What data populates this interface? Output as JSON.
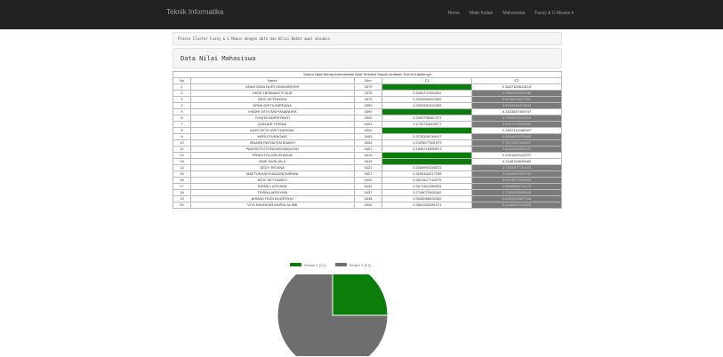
{
  "nav": {
    "brand": "Teknik Informatika",
    "links": [
      "Home",
      "Mata Kuliah",
      "Mahasiswa",
      "Fuzzy & C-Means ▾"
    ]
  },
  "notice": "Proses Cluster Fuzzy & C-Means dengan data dan Nilai Bobot awal dinamis",
  "section_title": "Data Nilai Mahasiswa",
  "table": {
    "caption": "Warna Hijau Merepresentasikan Nilai Tersebut Masuk kedalam Kolum Klasternya",
    "headers": [
      "No",
      "Nama",
      "Nim",
      "C1",
      "C2"
    ],
    "rows": [
      [
        "1",
        "ANASTASIA NURI GINANINGSIH",
        "3372",
        "",
        "0.3637160613219"
      ],
      [
        "2",
        "DEDE HERMANTO NUR",
        "3375",
        "0.4040747052652",
        "0.5959252947348"
      ],
      [
        "3",
        "DEDI SETYAWAN",
        "3379",
        "0.3269984322669",
        "0.6730015677331"
      ],
      [
        "4",
        "ERNA DHITA WIRDANA",
        "3390",
        "0.3305461624455",
        "0.6694538375545"
      ],
      [
        "5",
        "VINDHI DESI WIDYANANDRA",
        "3390",
        "",
        "0.3103637490747"
      ],
      [
        "6",
        "YUNITA NURHIYANTI",
        "3392",
        "0.2930796567477",
        "0.7069203432523"
      ],
      [
        "7",
        "GANJAR TRISNA",
        "3401",
        "0.1732784003977",
        "0.8267215996023"
      ],
      [
        "8",
        "HARI OKTA DWI TUKODAL",
        "3402",
        "",
        "0.2697112048307"
      ],
      [
        "9",
        "HERU PURNOMO",
        "3403",
        "0.3735106749017",
        "0.6264893250983"
      ],
      [
        "10",
        "ISNAINI RATNA RAHDIANTI",
        "3404",
        "0.2425677551973",
        "0.7574322448027"
      ],
      [
        "11",
        "PANGESTUTI RAHAYUNINGSIH",
        "3407",
        "0.1836716550873",
        "0.8163283449127"
      ],
      [
        "12",
        "PRADITYA DWI ATMAJA",
        "3410",
        "",
        "0.2091823129727"
      ],
      [
        "13",
        "ANIK NURLAILA",
        "3419",
        "",
        "0.2168763636482"
      ],
      [
        "14",
        "DEDY REGINA",
        "3421",
        "0.2166992259372",
        "0.7833007740628"
      ],
      [
        "15",
        "MAFTUKHAH FAAJUNGMIRANI",
        "3427",
        "0.3159164217256",
        "0.6840835782744"
      ],
      [
        "16",
        "NOVI SETYAWATI",
        "3432",
        "0.3523427744075",
        "0.6476572255925"
      ],
      [
        "17",
        "RISMA LUTFIANA",
        "3433",
        "0.3071611285825",
        "0.6928388714175"
      ],
      [
        "18",
        "TRISNA ARDIYANI",
        "3437",
        "0.2748070463182",
        "0.7251929536818"
      ],
      [
        "19",
        "AHMAD RUDI NUGROHO",
        "3438",
        "0.3045956632052",
        "0.6954043367948"
      ],
      [
        "20",
        "VITA SANGKAN MURNI ALAMI",
        "3442",
        "0.3551552081471",
        "0.6448447918529"
      ]
    ],
    "highlight_c1": [
      1,
      5,
      8,
      12,
      13
    ]
  },
  "chart_data": {
    "type": "pie",
    "legend_position": "top",
    "series": [
      {
        "name": "Kluster 1 (C1)",
        "value": 5,
        "color": "#0a7d0a"
      },
      {
        "name": "Kluster 2 (C2)",
        "value": 15,
        "color": "#6e6e6e"
      }
    ]
  }
}
